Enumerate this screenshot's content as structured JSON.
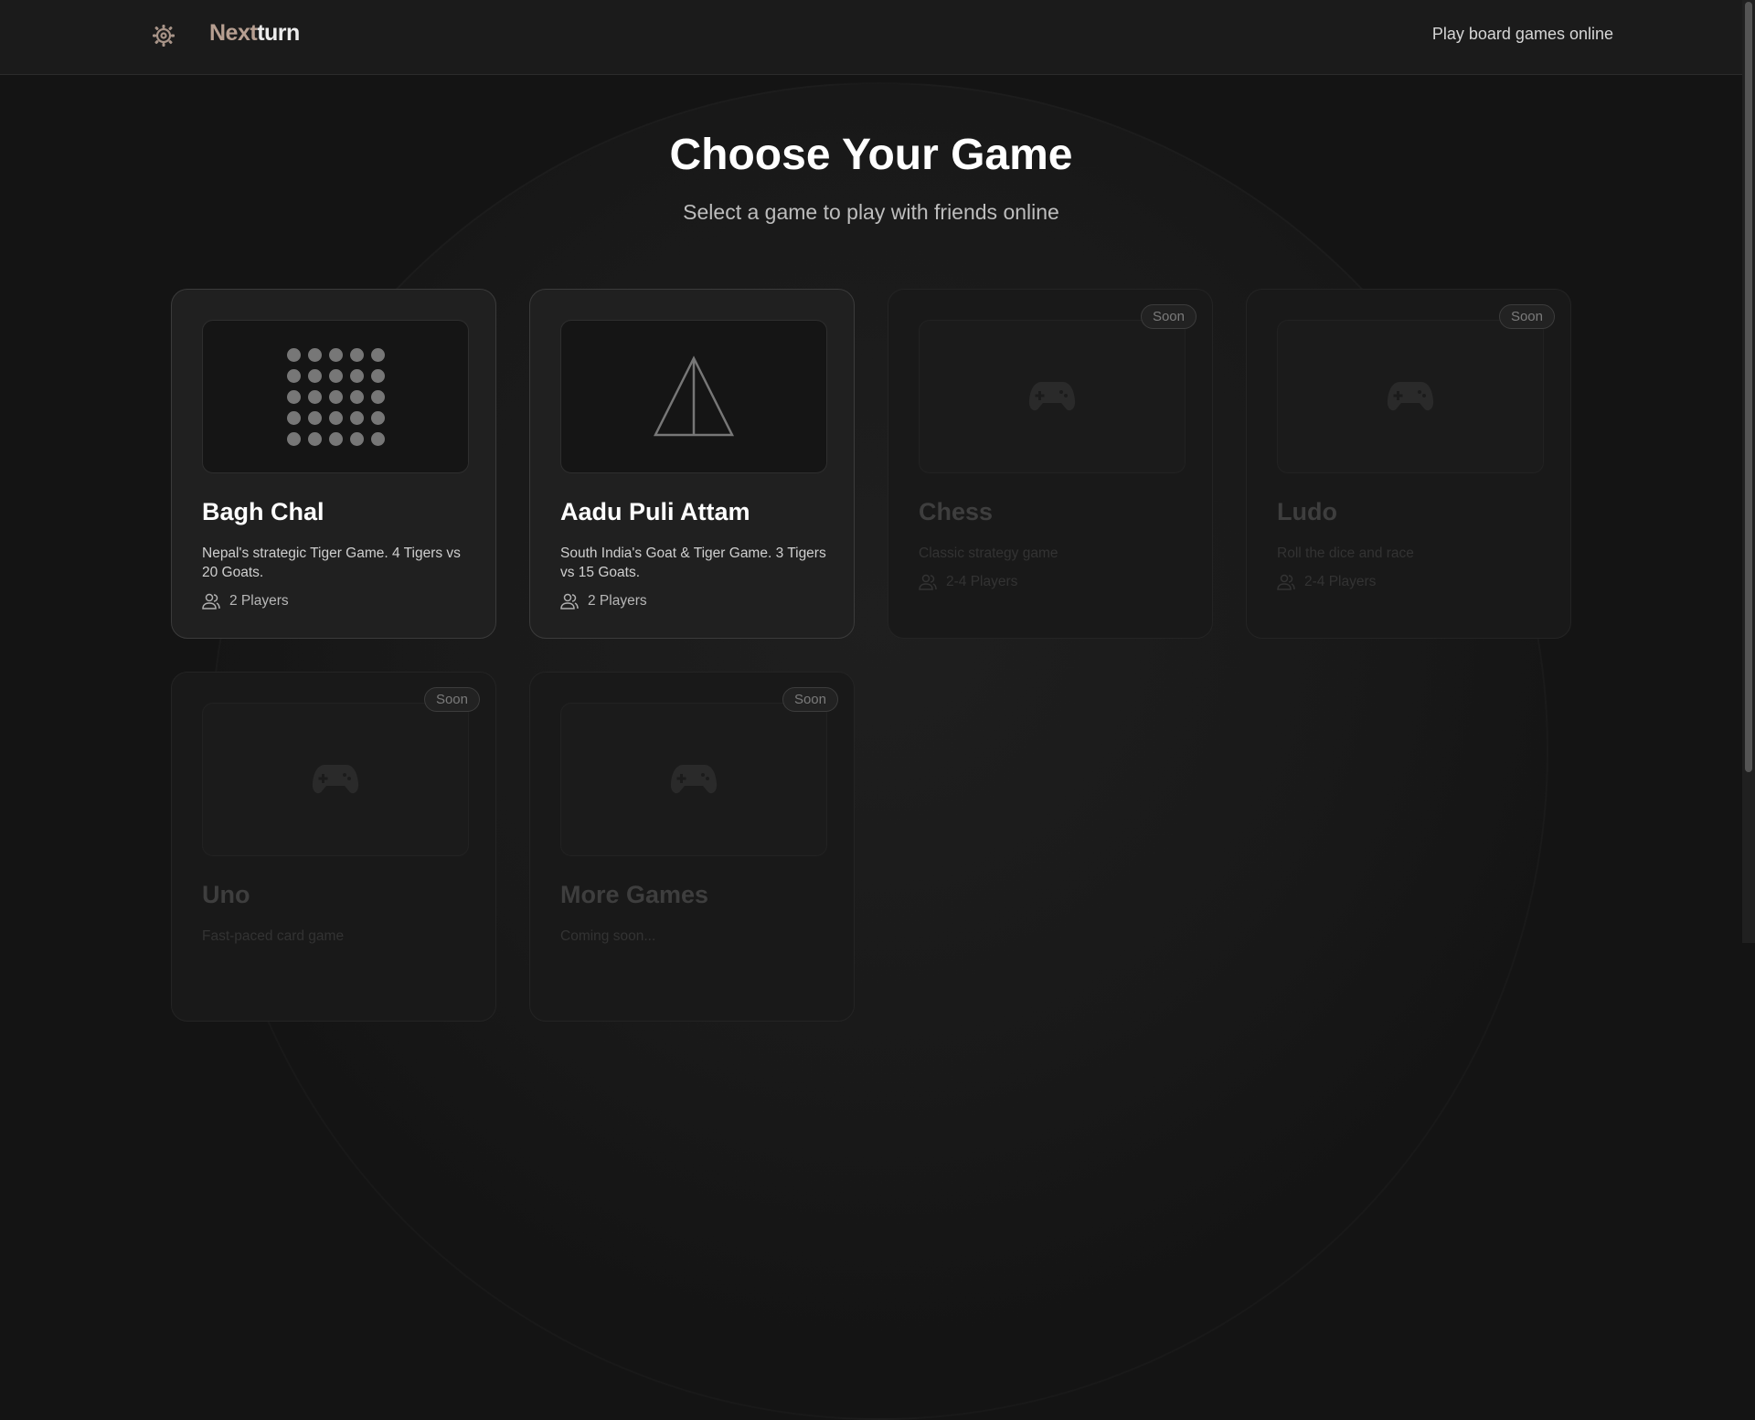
{
  "header": {
    "brand_part1": "Next",
    "brand_part2": "turn",
    "tagline": "Play board games online"
  },
  "hero": {
    "title": "Choose Your Game",
    "subtitle": "Select a game to play with friends online"
  },
  "games": [
    {
      "title": "Bagh Chal",
      "description": "Nepal's strategic Tiger Game. 4 Tigers vs 20 Goats.",
      "players": "2 Players",
      "icon": "dot-grid-icon"
    },
    {
      "title": "Aadu Puli Attam",
      "description": "South India's Goat & Tiger Game. 3 Tigers vs 15 Goats.",
      "players": "2 Players",
      "icon": "triangle-board-icon"
    },
    {
      "title": "Chess",
      "description": "Classic strategy game",
      "players": "2-4 Players",
      "badge": "Soon",
      "icon": "gamepad-icon"
    },
    {
      "title": "Ludo",
      "description": "Roll the dice and race",
      "players": "2-4 Players",
      "badge": "Soon",
      "icon": "gamepad-icon"
    },
    {
      "title": "Uno",
      "description": "Fast-paced card game",
      "badge": "Soon",
      "icon": "gamepad-icon"
    },
    {
      "title": "More Games",
      "description": "Coming soon...",
      "badge": "Soon",
      "icon": "gamepad-icon"
    }
  ],
  "colors": {
    "background": "#141414",
    "brand_accent": "#b79f91",
    "card": "#202020"
  }
}
